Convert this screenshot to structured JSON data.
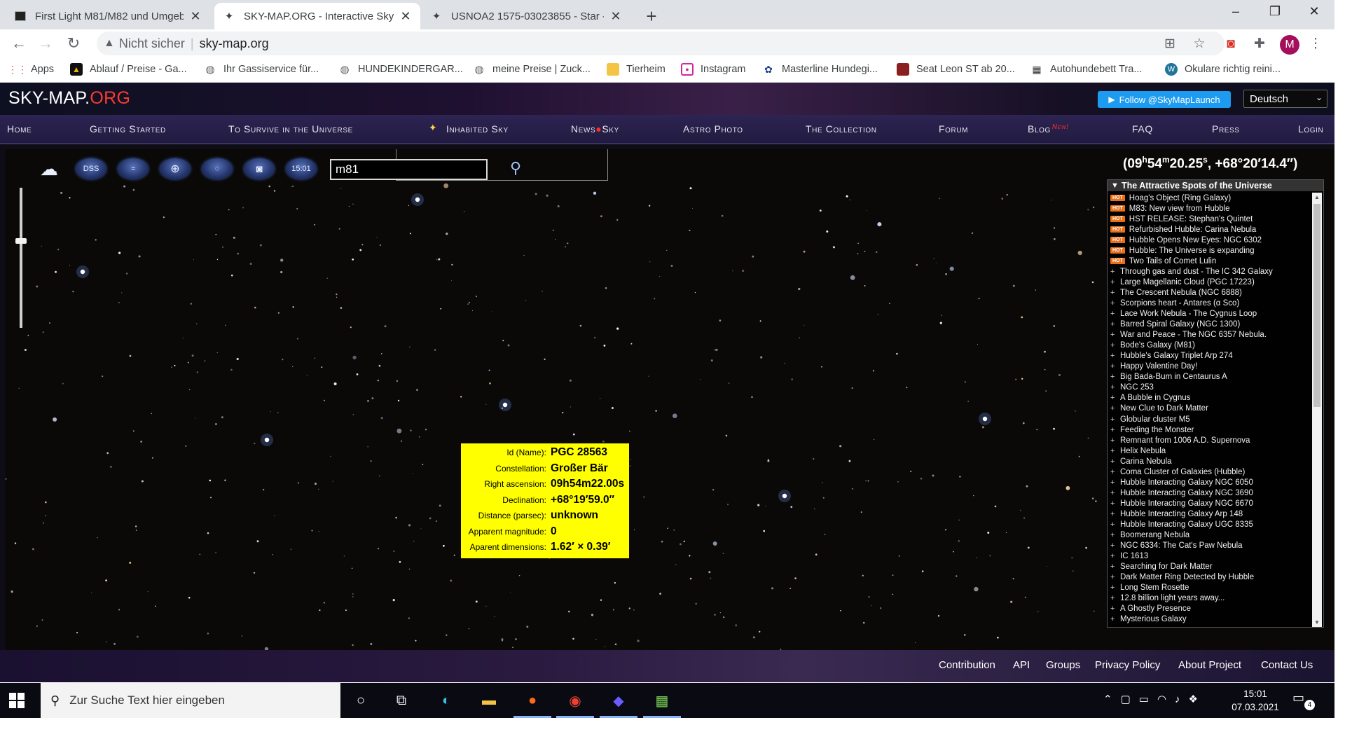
{
  "browser": {
    "tabs": [
      {
        "title": "First Light M81/M82 und Umgeb",
        "icon": "photo-favicon"
      },
      {
        "title": "SKY-MAP.ORG - Interactive Sky M",
        "icon": "star-favicon"
      },
      {
        "title": "USNOA2 1575-03023855 - Star -",
        "icon": "star-favicon"
      }
    ],
    "new_tab": "+",
    "window_controls": [
      "–",
      "❐",
      "✕"
    ],
    "address": {
      "security": "Nicht sicher",
      "url": "sky-map.org"
    },
    "profile_initial": "M",
    "bookmarks": [
      {
        "label": "Apps",
        "icon": "apps-grid-icon",
        "color": "#e94235"
      },
      {
        "label": "Ablauf / Preise - Ga...",
        "icon": "bookmark-favicon",
        "color": "#f4b400"
      },
      {
        "label": "Ihr Gassiservice für...",
        "icon": "globe-icon",
        "color": "#5f6368"
      },
      {
        "label": "HUNDEKINDERGAR...",
        "icon": "globe-icon",
        "color": "#5f6368"
      },
      {
        "label": "meine Preise | Zuck...",
        "icon": "globe-icon",
        "color": "#5f6368"
      },
      {
        "label": "Tierheim",
        "icon": "folder-icon",
        "color": "#f4c542"
      },
      {
        "label": "Instagram",
        "icon": "instagram-icon",
        "color": "#d6249f"
      },
      {
        "label": "Masterline Hundegi...",
        "icon": "paw-icon",
        "color": "#1a3c8a"
      },
      {
        "label": "Seat Leon ST ab 20...",
        "icon": "car-favicon",
        "color": "#8a1f1f"
      },
      {
        "label": "Autohundebett Tra...",
        "icon": "dog-favicon",
        "color": "#333333"
      },
      {
        "label": "Okulare richtig reini...",
        "icon": "wordpress-icon",
        "color": "#21759b"
      }
    ]
  },
  "site": {
    "logo": {
      "main": "SKY-MAP.",
      "accent": "ORG"
    },
    "follow_label": "Follow @SkyMapLaunch",
    "language": "Deutsch",
    "nav": [
      {
        "label": "Home"
      },
      {
        "label": "Getting Started"
      },
      {
        "label": "To Survive in the Universe"
      },
      {
        "label": "Inhabited Sky"
      },
      {
        "label": "News",
        "mid": "●",
        "label2": "Sky"
      },
      {
        "label": "Astro Photo"
      },
      {
        "label": "The Collection"
      },
      {
        "label": "Forum"
      },
      {
        "label": "Blog",
        "badge": "New!"
      },
      {
        "label": "FAQ"
      },
      {
        "label": "Press"
      },
      {
        "label": "Login"
      }
    ],
    "map_toolbar": [
      {
        "name": "sky-mode-icon",
        "label": ""
      },
      {
        "name": "dss-button",
        "label": "DSS"
      },
      {
        "name": "milky-way-button",
        "label": ""
      },
      {
        "name": "globe-grid-button",
        "label": ""
      },
      {
        "name": "galaxy-button",
        "label": ""
      },
      {
        "name": "camera-button",
        "label": ""
      },
      {
        "name": "time-button",
        "label": "15:01"
      }
    ],
    "search_value": "m81",
    "coordinates": {
      "ra_h": "09",
      "ra_m": "54",
      "ra_s": "20.25",
      "dec": "+68°20′14.4″"
    },
    "info": {
      "rows": [
        {
          "key": "Id (Name):",
          "value": "PGC 28563"
        },
        {
          "key": "Constellation:",
          "value": "Großer Bär"
        },
        {
          "key": "Right ascension:",
          "value": "09h54m22.00s"
        },
        {
          "key": "Declination:",
          "value": "+68°19′59.0″"
        },
        {
          "key": "Distance (parsec):",
          "value": "unknown"
        },
        {
          "key": "Apparent magnitude:",
          "value": "0"
        },
        {
          "key": "Aparent dimensions:",
          "value": "1.62′ × 0.39′"
        }
      ]
    },
    "spots": {
      "title": "The Attractive Spots of the Universe",
      "hot_label": "HOT",
      "items": [
        {
          "hot": true,
          "label": "Hoag's Object (Ring Galaxy)"
        },
        {
          "hot": true,
          "label": "M83: New view from Hubble"
        },
        {
          "hot": true,
          "label": "HST RELEASE: Stephan's Quintet"
        },
        {
          "hot": true,
          "label": "Refurbished Hubble: Carina Nebula"
        },
        {
          "hot": true,
          "label": "Hubble Opens New Eyes: NGC 6302"
        },
        {
          "hot": true,
          "label": "Hubble: The Universe is expanding"
        },
        {
          "hot": true,
          "label": "Two Tails of Comet Lulin"
        },
        {
          "hot": false,
          "label": "Through gas and dust - The IC 342 Galaxy"
        },
        {
          "hot": false,
          "label": "Large Magellanic Cloud (PGC 17223)"
        },
        {
          "hot": false,
          "label": "The Crescent Nebula (NGC 6888)"
        },
        {
          "hot": false,
          "label": "Scorpions heart - Antares (α Sco)"
        },
        {
          "hot": false,
          "label": "Lace Work Nebula - The Cygnus Loop"
        },
        {
          "hot": false,
          "label": "Barred Spiral Galaxy (NGC 1300)"
        },
        {
          "hot": false,
          "label": "War and Peace - The NGC 6357 Nebula."
        },
        {
          "hot": false,
          "label": "Bode's Galaxy (M81)"
        },
        {
          "hot": false,
          "label": "Hubble's Galaxy Triplet Arp 274"
        },
        {
          "hot": false,
          "label": "Happy Valentine Day!"
        },
        {
          "hot": false,
          "label": "Big Bada-Bum in Centaurus A"
        },
        {
          "hot": false,
          "label": "NGC 253"
        },
        {
          "hot": false,
          "label": "A Bubble in Cygnus"
        },
        {
          "hot": false,
          "label": "New Clue to Dark Matter"
        },
        {
          "hot": false,
          "label": "Globular cluster M5"
        },
        {
          "hot": false,
          "label": "Feeding the Monster"
        },
        {
          "hot": false,
          "label": "Remnant from 1006 A.D. Supernova"
        },
        {
          "hot": false,
          "label": "Helix Nebula"
        },
        {
          "hot": false,
          "label": "Carina Nebula"
        },
        {
          "hot": false,
          "label": "Coma Cluster of Galaxies (Hubble)"
        },
        {
          "hot": false,
          "label": "Hubble Interacting Galaxy NGC 6050"
        },
        {
          "hot": false,
          "label": "Hubble Interacting Galaxy NGC 3690"
        },
        {
          "hot": false,
          "label": "Hubble Interacting Galaxy NGC 6670"
        },
        {
          "hot": false,
          "label": "Hubble Interacting Galaxy Arp 148"
        },
        {
          "hot": false,
          "label": "Hubble Interacting Galaxy UGC 8335"
        },
        {
          "hot": false,
          "label": "Boomerang Nebula"
        },
        {
          "hot": false,
          "label": "NGC 6334: The Cat's Paw Nebula"
        },
        {
          "hot": false,
          "label": "IC 1613"
        },
        {
          "hot": false,
          "label": "Searching for Dark Matter"
        },
        {
          "hot": false,
          "label": "Dark Matter Ring Detected by Hubble"
        },
        {
          "hot": false,
          "label": " Long Stem Rosette"
        },
        {
          "hot": false,
          "label": "12.8 billion light years away..."
        },
        {
          "hot": false,
          "label": "A Ghostly Presence"
        },
        {
          "hot": false,
          "label": "Mysterious Galaxy"
        }
      ]
    },
    "footer": [
      "Contribution",
      "API",
      "Groups",
      "Privacy Policy",
      "About Project",
      "Contact Us"
    ]
  },
  "taskbar": {
    "search_placeholder": "Zur Suche Text hier eingeben",
    "time": "15:01",
    "date": "07.03.2021",
    "notification_count": "4"
  }
}
